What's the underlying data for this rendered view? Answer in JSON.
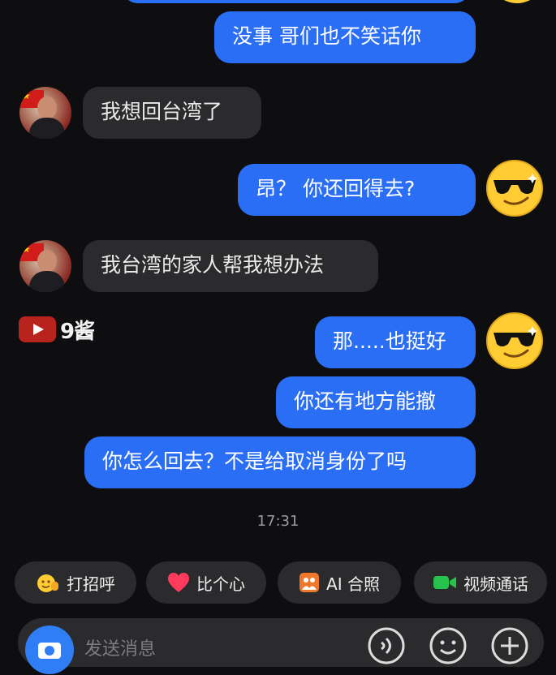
{
  "messages": [
    {
      "side": "out",
      "text": "没事 哥们也不笑话你"
    },
    {
      "side": "in",
      "text": "我想回台湾了"
    },
    {
      "side": "out",
      "text": "昂？ 你还回得去?"
    },
    {
      "side": "in",
      "text": "我台湾的家人帮我想办法"
    },
    {
      "side": "out",
      "text": "那.....也挺好"
    },
    {
      "side": "out",
      "text": "你还有地方能撤"
    },
    {
      "side": "out",
      "text": "你怎么回去？不是给取消身份了吗"
    }
  ],
  "timestamp": "17:31",
  "watermark": {
    "text": "9酱"
  },
  "quick_actions": [
    {
      "label": "打招呼",
      "icon": "wave-hand-icon"
    },
    {
      "label": "比个心",
      "icon": "heart-icon"
    },
    {
      "label": "AI 合照",
      "icon": "photo-portrait-icon"
    },
    {
      "label": "视频通话",
      "icon": "video-camera-icon"
    }
  ],
  "composer": {
    "placeholder": "发送消息"
  },
  "colors": {
    "outgoing": "#2a6ef5",
    "incoming": "#2b2b2e",
    "background": "#0e0e10"
  }
}
